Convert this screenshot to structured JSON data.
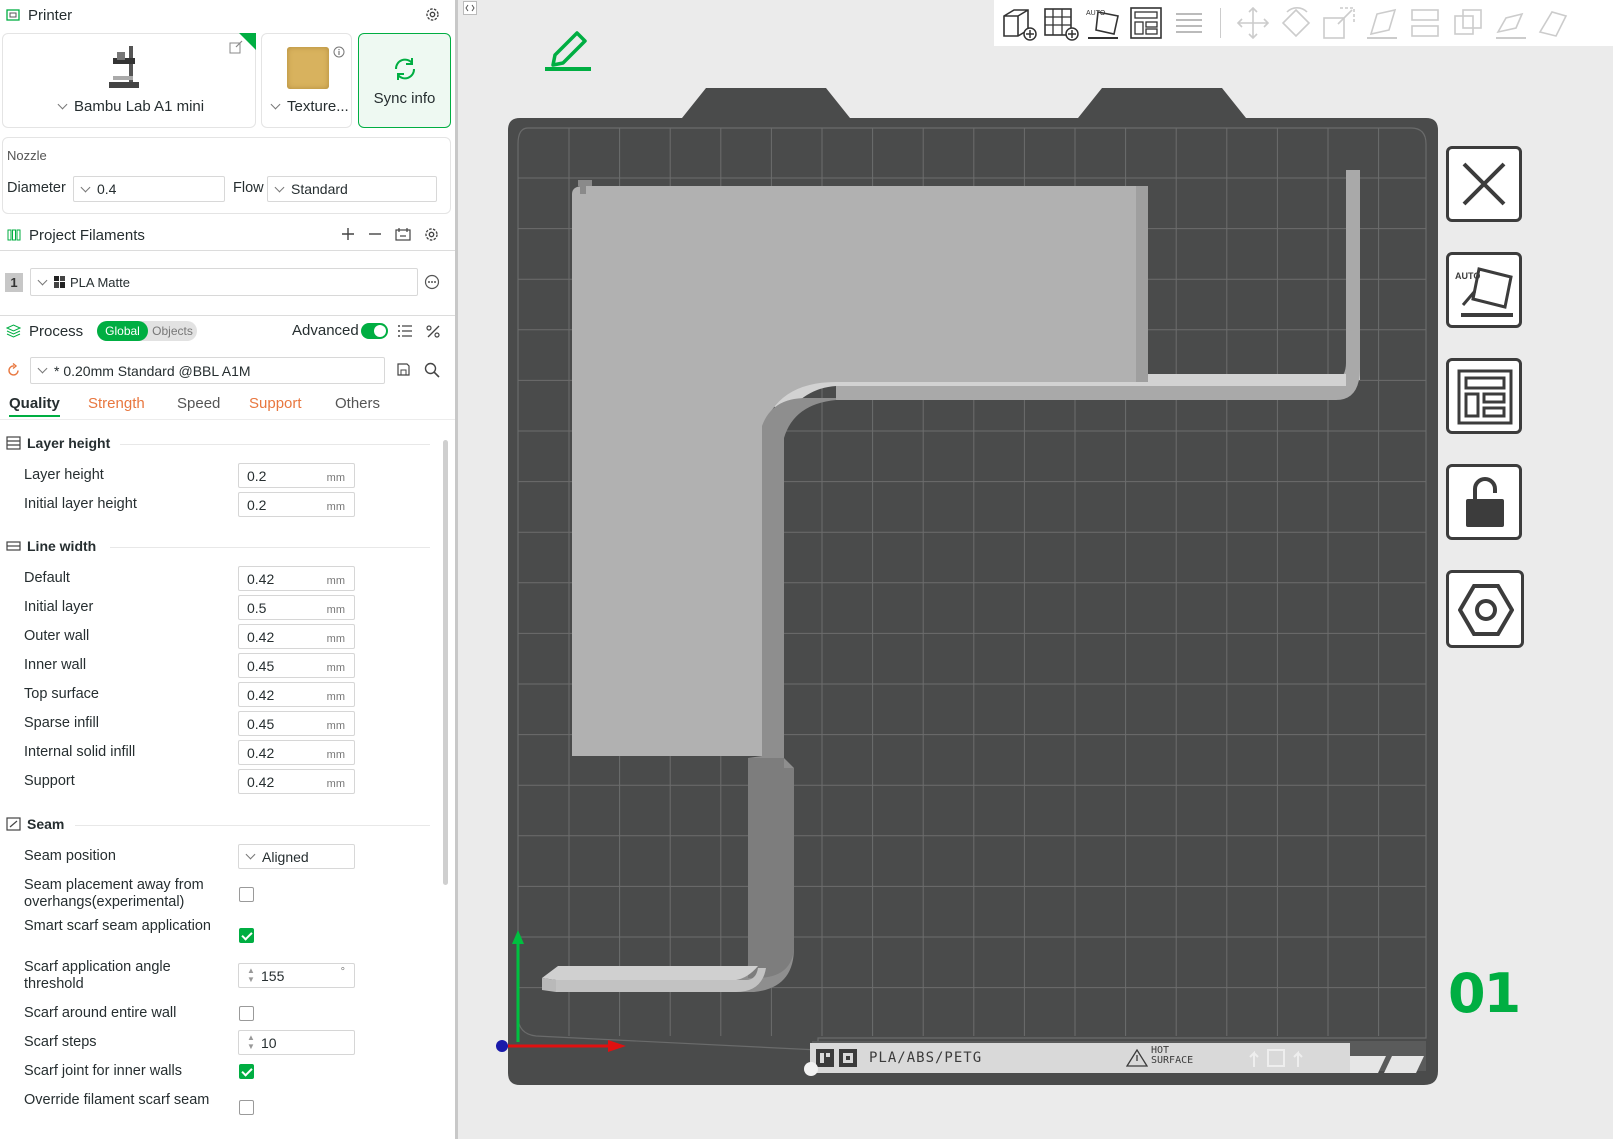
{
  "printer": {
    "section_title": "Printer",
    "printer_name": "Bambu Lab A1 mini",
    "plate_type": "Texture...",
    "sync_label": "Sync info"
  },
  "nozzle": {
    "section_label": "Nozzle",
    "diameter_label": "Diameter",
    "diameter_value": "0.4",
    "flow_label": "Flow",
    "flow_value": "Standard"
  },
  "filaments": {
    "section_title": "Project Filaments",
    "items": [
      {
        "index": "1",
        "name": "PLA Matte"
      }
    ]
  },
  "process": {
    "section_title": "Process",
    "toggle_global": "Global",
    "toggle_objects": "Objects",
    "advanced_label": "Advanced",
    "preset": "* 0.20mm Standard @BBL A1M",
    "tabs": [
      "Quality",
      "Strength",
      "Speed",
      "Support",
      "Others"
    ]
  },
  "quality": {
    "layer_height": {
      "title": "Layer height",
      "rows": [
        {
          "label": "Layer height",
          "value": "0.2",
          "unit": "mm"
        },
        {
          "label": "Initial layer height",
          "value": "0.2",
          "unit": "mm"
        }
      ]
    },
    "line_width": {
      "title": "Line width",
      "rows": [
        {
          "label": "Default",
          "value": "0.42",
          "unit": "mm"
        },
        {
          "label": "Initial layer",
          "value": "0.5",
          "unit": "mm"
        },
        {
          "label": "Outer wall",
          "value": "0.42",
          "unit": "mm"
        },
        {
          "label": "Inner wall",
          "value": "0.45",
          "unit": "mm"
        },
        {
          "label": "Top surface",
          "value": "0.42",
          "unit": "mm"
        },
        {
          "label": "Sparse infill",
          "value": "0.45",
          "unit": "mm"
        },
        {
          "label": "Internal solid infill",
          "value": "0.42",
          "unit": "mm"
        },
        {
          "label": "Support",
          "value": "0.42",
          "unit": "mm"
        }
      ]
    },
    "seam": {
      "title": "Seam",
      "seam_position_label": "Seam position",
      "seam_position_value": "Aligned",
      "placement_label": "Seam placement away from overhangs(experimental)",
      "placement_checked": false,
      "smart_scarf_label": "Smart scarf seam application",
      "smart_scarf_checked": true,
      "angle_label": "Scarf application angle threshold",
      "angle_value": "155",
      "angle_unit": "°",
      "around_label": "Scarf around entire wall",
      "around_checked": false,
      "steps_label": "Scarf steps",
      "steps_value": "10",
      "inner_label": "Scarf joint for inner walls",
      "inner_checked": true,
      "override_label": "Override filament scarf seam"
    }
  },
  "plate": {
    "number": "01",
    "material_label": "PLA/ABS/PETG",
    "hot_label": "HOT",
    "surface_label": "SURFACE",
    "auto_label": "AUTO"
  },
  "colors": {
    "accent": "#00ae42",
    "orange": "#e8773f",
    "bed": "#4a4b4b",
    "model": "#b3b3b3"
  }
}
